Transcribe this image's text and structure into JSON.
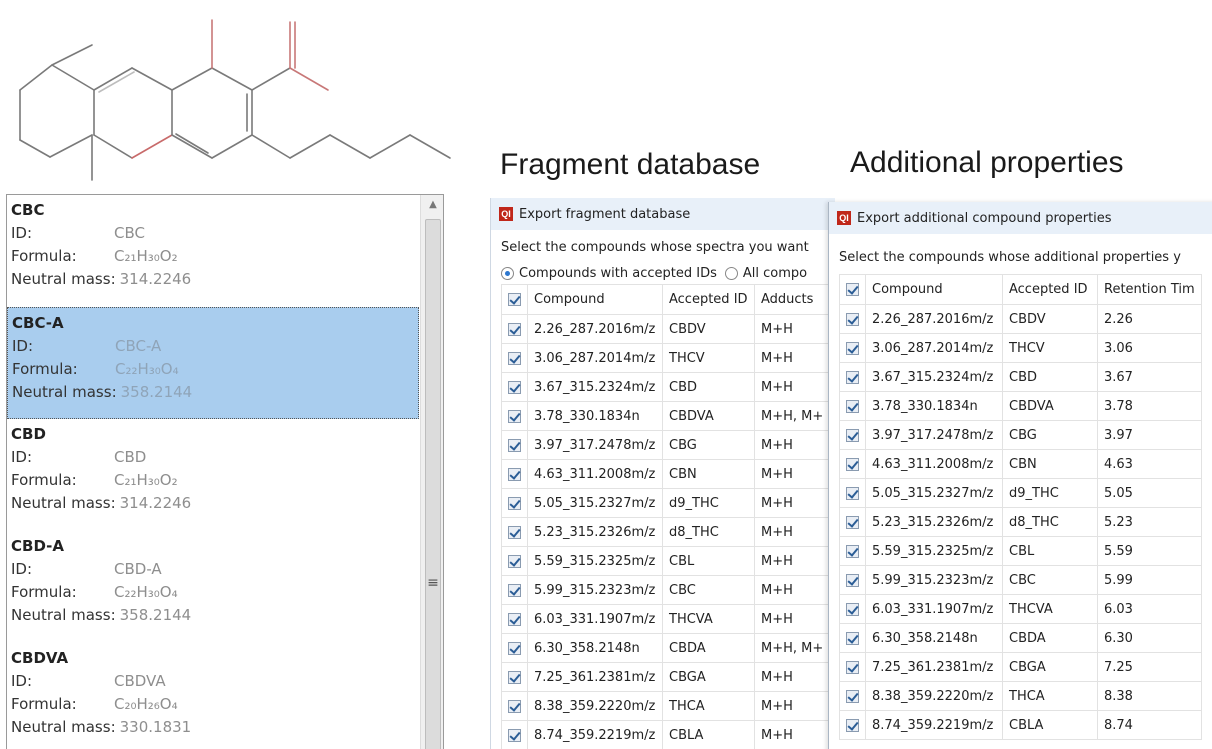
{
  "titles": {
    "fragment_database": "Fragment database",
    "additional_properties": "Additional properties"
  },
  "compound_list": {
    "labels": {
      "id": "ID:",
      "formula": "Formula:",
      "neutral_mass": "Neutral mass:"
    },
    "items": [
      {
        "name": "CBC",
        "id": "CBC",
        "formula": "C₂₁H₃₀O₂",
        "neutral_mass": "314.2246",
        "selected": false
      },
      {
        "name": "CBC-A",
        "id": "CBC-A",
        "formula": "C₂₂H₃₀O₄",
        "neutral_mass": "358.2144",
        "selected": true
      },
      {
        "name": "CBD",
        "id": "CBD",
        "formula": "C₂₁H₃₀O₂",
        "neutral_mass": "314.2246",
        "selected": false
      },
      {
        "name": "CBD-A",
        "id": "CBD-A",
        "formula": "C₂₂H₃₀O₄",
        "neutral_mass": "358.2144",
        "selected": false
      },
      {
        "name": "CBDVA",
        "id": "CBDVA",
        "formula": "C₂₀H₂₆O₄",
        "neutral_mass": "330.1831",
        "selected": false
      }
    ]
  },
  "fragment_dialog": {
    "logo": "QI",
    "title": "Export fragment database",
    "instruction": "Select the compounds whose spectra you want",
    "radio_accepted": "Compounds with accepted IDs",
    "radio_all": "All compo",
    "columns": [
      "Compound",
      "Accepted ID",
      "Adducts"
    ],
    "rows": [
      [
        "2.26_287.2016m/z",
        "CBDV",
        "M+H"
      ],
      [
        "3.06_287.2014m/z",
        "THCV",
        "M+H"
      ],
      [
        "3.67_315.2324m/z",
        "CBD",
        "M+H"
      ],
      [
        "3.78_330.1834n",
        "CBDVA",
        "M+H, M+"
      ],
      [
        "3.97_317.2478m/z",
        "CBG",
        "M+H"
      ],
      [
        "4.63_311.2008m/z",
        "CBN",
        "M+H"
      ],
      [
        "5.05_315.2327m/z",
        "d9_THC",
        "M+H"
      ],
      [
        "5.23_315.2326m/z",
        "d8_THC",
        "M+H"
      ],
      [
        "5.59_315.2325m/z",
        "CBL",
        "M+H"
      ],
      [
        "5.99_315.2323m/z",
        "CBC",
        "M+H"
      ],
      [
        "6.03_331.1907m/z",
        "THCVA",
        "M+H"
      ],
      [
        "6.30_358.2148n",
        "CBDA",
        "M+H, M+"
      ],
      [
        "7.25_361.2381m/z",
        "CBGA",
        "M+H"
      ],
      [
        "8.38_359.2220m/z",
        "THCA",
        "M+H"
      ],
      [
        "8.74_359.2219m/z",
        "CBLA",
        "M+H"
      ]
    ]
  },
  "properties_dialog": {
    "logo": "QI",
    "title": "Export additional compound properties",
    "instruction": "Select the compounds whose additional properties y",
    "columns": [
      "Compound",
      "Accepted ID",
      "Retention Tim"
    ],
    "rows": [
      [
        "2.26_287.2016m/z",
        "CBDV",
        "2.26"
      ],
      [
        "3.06_287.2014m/z",
        "THCV",
        "3.06"
      ],
      [
        "3.67_315.2324m/z",
        "CBD",
        "3.67"
      ],
      [
        "3.78_330.1834n",
        "CBDVA",
        "3.78"
      ],
      [
        "3.97_317.2478m/z",
        "CBG",
        "3.97"
      ],
      [
        "4.63_311.2008m/z",
        "CBN",
        "4.63"
      ],
      [
        "5.05_315.2327m/z",
        "d9_THC",
        "5.05"
      ],
      [
        "5.23_315.2326m/z",
        "d8_THC",
        "5.23"
      ],
      [
        "5.59_315.2325m/z",
        "CBL",
        "5.59"
      ],
      [
        "5.99_315.2323m/z",
        "CBC",
        "5.99"
      ],
      [
        "6.03_331.1907m/z",
        "THCVA",
        "6.03"
      ],
      [
        "6.30_358.2148n",
        "CBDA",
        "6.30"
      ],
      [
        "7.25_361.2381m/z",
        "CBGA",
        "7.25"
      ],
      [
        "8.38_359.2220m/z",
        "THCA",
        "8.38"
      ],
      [
        "8.74_359.2219m/z",
        "CBLA",
        "8.74"
      ]
    ]
  },
  "colors": {
    "selection": "#a9cdee",
    "titlebar": "#e8f0f9",
    "logo": "#c0271a",
    "checkmark": "#2b5d96"
  }
}
